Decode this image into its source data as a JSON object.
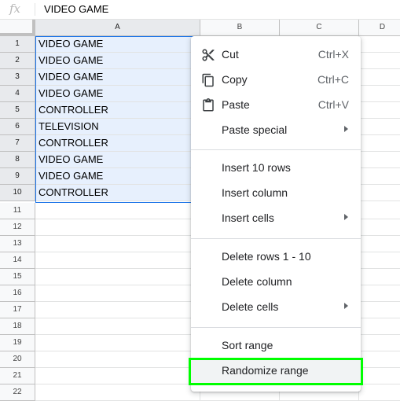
{
  "formula_bar": {
    "fx_label": "fx",
    "value": "VIDEO GAME"
  },
  "columns": [
    "A",
    "B",
    "C",
    "D"
  ],
  "rows": [
    "1",
    "2",
    "3",
    "4",
    "5",
    "6",
    "7",
    "8",
    "9",
    "10",
    "11",
    "12",
    "13",
    "14",
    "15",
    "16",
    "17",
    "18",
    "19",
    "20",
    "21",
    "22"
  ],
  "column_a": [
    "VIDEO GAME",
    "VIDEO GAME",
    "VIDEO GAME",
    "VIDEO GAME",
    "CONTROLLER",
    "TELEVISION",
    "CONTROLLER",
    "VIDEO GAME",
    "VIDEO GAME",
    "CONTROLLER"
  ],
  "menu": {
    "cut": {
      "label": "Cut",
      "shortcut": "Ctrl+X",
      "icon": "scissors-icon"
    },
    "copy": {
      "label": "Copy",
      "shortcut": "Ctrl+C",
      "icon": "copy-icon"
    },
    "paste": {
      "label": "Paste",
      "shortcut": "Ctrl+V",
      "icon": "clipboard-icon"
    },
    "paste_special": {
      "label": "Paste special"
    },
    "insert_rows": {
      "label": "Insert 10 rows"
    },
    "insert_column": {
      "label": "Insert column"
    },
    "insert_cells": {
      "label": "Insert cells"
    },
    "delete_rows": {
      "label": "Delete rows 1 - 10"
    },
    "delete_column": {
      "label": "Delete column"
    },
    "delete_cells": {
      "label": "Delete cells"
    },
    "sort_range": {
      "label": "Sort range"
    },
    "randomize_range": {
      "label": "Randomize range"
    }
  },
  "colors": {
    "selection": "#e7f0fd",
    "selection_border": "#1a73e8",
    "highlight_box": "#00ff00"
  }
}
